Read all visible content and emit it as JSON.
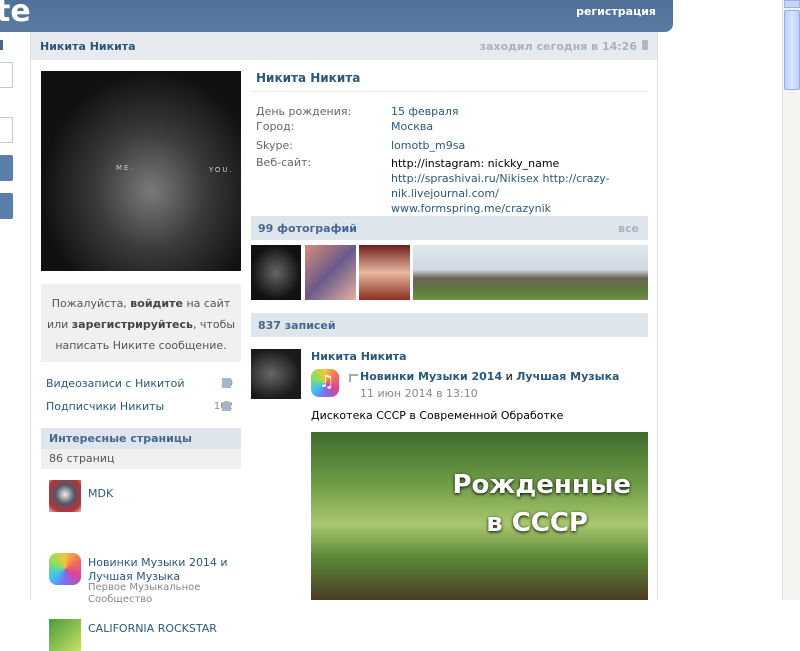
{
  "header": {
    "logo": "te",
    "register": "регистрация"
  },
  "profile_header": {
    "name": "Никита Никита",
    "last_seen": "заходил сегодня в 14:26"
  },
  "avatar": {
    "label_me": "ME.",
    "label_you": "YOU."
  },
  "message_box": {
    "part1": "Пожалуйста, ",
    "login": "войдите",
    "part2": " на сайт или ",
    "register": "зарегистрируйтесь",
    "part3": ", чтобы написать Никите сообщение."
  },
  "side_links": [
    {
      "label": "Видеозаписи с Никитой",
      "count": "10"
    },
    {
      "label": "Подписчики Никиты",
      "count": "102"
    }
  ],
  "interesting_pages": {
    "title": "Интересные страницы",
    "count": "86 страниц",
    "items": [
      {
        "name": "MDK",
        "desc": ""
      },
      {
        "name": "Новинки Музыки 2014 и Лучшая Музыка",
        "desc": "Первое Музыкальное Сообщество"
      },
      {
        "name": "CALIFORNIA ROCKSTAR",
        "desc": ""
      }
    ]
  },
  "info": {
    "name": "Никита Никита",
    "rows": [
      {
        "label": "День рождения:",
        "value": "15 февраля"
      },
      {
        "label": "Город:",
        "value": "Москва"
      },
      {
        "label": "Skype:",
        "value": "lomotb_m9sa"
      },
      {
        "label": "Веб-сайт:",
        "value": ""
      }
    ],
    "website_plain": "http://instagram: nickky_name ",
    "website_link1": "http://sprashivai.ru/Nikisex",
    "website_link2": "http://crazy-nik.livejournal.com/",
    "website_link3": "www.formspring.me/crazynik"
  },
  "photos": {
    "title": "99 фотографий",
    "all": "все"
  },
  "wall": {
    "title": "837 записей",
    "post": {
      "author": "Никита Никита",
      "source1": "Новинки Музыки 2014",
      "and": " и ",
      "source2": "Лучшая Музыка",
      "date": "11 июн 2014 в 13:10",
      "text": "Дискотека СССР в Современной Обработке",
      "image_line1": "Рожденные",
      "image_line2": "в СССР"
    }
  }
}
